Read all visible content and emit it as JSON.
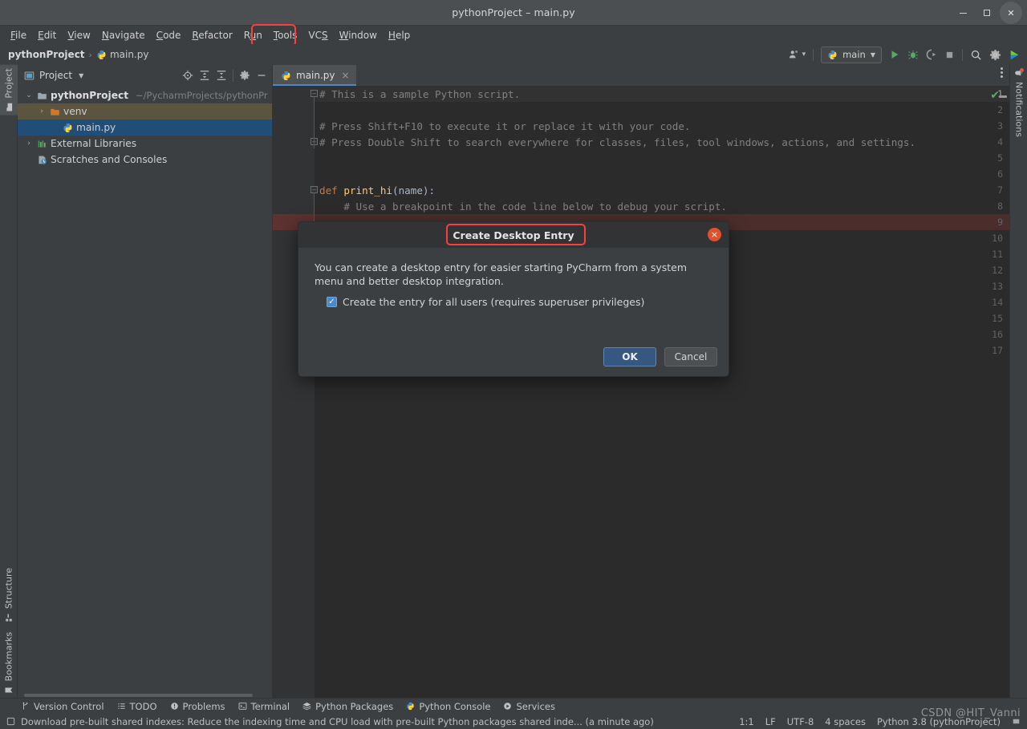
{
  "window": {
    "title": "pythonProject – main.py",
    "minimize_label": "Minimize",
    "maximize_label": "Maximize",
    "close_label": "Close"
  },
  "menubar": {
    "items": [
      {
        "label": "File",
        "mnemonic": "F"
      },
      {
        "label": "Edit",
        "mnemonic": "E"
      },
      {
        "label": "View",
        "mnemonic": "V"
      },
      {
        "label": "Navigate",
        "mnemonic": "N"
      },
      {
        "label": "Code",
        "mnemonic": "C"
      },
      {
        "label": "Refactor",
        "mnemonic": "R"
      },
      {
        "label": "Run",
        "mnemonic": "u"
      },
      {
        "label": "Tools",
        "mnemonic": "T"
      },
      {
        "label": "VCS",
        "mnemonic": "S"
      },
      {
        "label": "Window",
        "mnemonic": "W"
      },
      {
        "label": "Help",
        "mnemonic": "H"
      }
    ],
    "highlighted": "Tools"
  },
  "navbar": {
    "project_name": "pythonProject",
    "separator": "›",
    "file_name": "main.py",
    "account_label": "Account",
    "run_config": "main",
    "run_label": "Run",
    "debug_label": "Debug",
    "coverage_label": "Run with Coverage",
    "stop_label": "Stop",
    "search_label": "Search Everywhere",
    "settings_label": "Settings",
    "ai_label": "AI Assistant"
  },
  "left_strip": {
    "tabs": [
      {
        "label": "Project",
        "icon": "project-icon",
        "active": true
      },
      {
        "label": "Structure",
        "icon": "structure-icon",
        "active": false
      },
      {
        "label": "Bookmarks",
        "icon": "bookmark-icon",
        "active": false
      }
    ]
  },
  "right_strip": {
    "tabs": [
      {
        "label": "Notifications",
        "icon": "bell-icon",
        "badge": true
      }
    ]
  },
  "project_panel": {
    "title": "Project",
    "toolbar": [
      {
        "name": "locate-icon",
        "label": "Select Opened File"
      },
      {
        "name": "expand-all-icon",
        "label": "Expand All"
      },
      {
        "name": "collapse-all-icon",
        "label": "Collapse All"
      },
      {
        "name": "gear-icon",
        "label": "Options"
      },
      {
        "name": "minimize-icon",
        "label": "Hide"
      }
    ],
    "tree": [
      {
        "label": "pythonProject",
        "path": "~/PycharmProjects/pythonPr",
        "indent": 0,
        "arrow": "⌄",
        "icon": "folder-icon",
        "bold": true,
        "state": "normal"
      },
      {
        "label": "venv",
        "path": "",
        "indent": 1,
        "arrow": "›",
        "icon": "folder-orange-icon",
        "bold": false,
        "state": "hover"
      },
      {
        "label": "main.py",
        "path": "",
        "indent": 2,
        "arrow": "",
        "icon": "python-file-icon",
        "bold": false,
        "state": "selected"
      },
      {
        "label": "External Libraries",
        "path": "",
        "indent": 0,
        "arrow": "›",
        "icon": "libraries-icon",
        "bold": false,
        "state": "normal"
      },
      {
        "label": "Scratches and Consoles",
        "path": "",
        "indent": 0,
        "arrow": "",
        "icon": "scratches-icon",
        "bold": false,
        "state": "normal"
      }
    ]
  },
  "editor": {
    "tabs": [
      {
        "label": "main.py",
        "icon": "python-file-icon",
        "active": true,
        "close": "×"
      }
    ],
    "options_label": "Options",
    "inspection_status": "✔",
    "lines": [
      {
        "n": "1",
        "segments": [
          {
            "t": "# This is a sample Python script.",
            "c": "cmt"
          }
        ],
        "fold": "minus",
        "highlight": "caret"
      },
      {
        "n": "2",
        "segments": [],
        "fold": "",
        "highlight": ""
      },
      {
        "n": "3",
        "segments": [
          {
            "t": "# Press Shift+F10 to execute it or replace it with your code.",
            "c": "cmt"
          }
        ],
        "fold": "",
        "highlight": ""
      },
      {
        "n": "4",
        "segments": [
          {
            "t": "# Press Double Shift to search everywhere for classes, files, tool windows, actions, and settings.",
            "c": "cmt"
          }
        ],
        "fold": "minus",
        "highlight": ""
      },
      {
        "n": "5",
        "segments": [],
        "fold": "",
        "highlight": ""
      },
      {
        "n": "6",
        "segments": [],
        "fold": "",
        "highlight": ""
      },
      {
        "n": "7",
        "segments": [
          {
            "t": "def ",
            "c": "kw"
          },
          {
            "t": "print_hi",
            "c": "fn"
          },
          {
            "t": "(name):",
            "c": "pln"
          }
        ],
        "fold": "minus",
        "highlight": ""
      },
      {
        "n": "8",
        "segments": [
          {
            "t": "    # Use a breakpoint in the code line below to debug your script.",
            "c": "cmt"
          }
        ],
        "fold": "",
        "highlight": ""
      },
      {
        "n": "9",
        "segments": [],
        "fold": "",
        "highlight": "breakpoint"
      },
      {
        "n": "10",
        "segments": [],
        "fold": "",
        "highlight": ""
      },
      {
        "n": "11",
        "segments": [],
        "fold": "",
        "highlight": ""
      },
      {
        "n": "12",
        "segments": [],
        "fold": "",
        "highlight": ""
      },
      {
        "n": "13",
        "segments": [],
        "fold": "",
        "highlight": "",
        "changed": true
      },
      {
        "n": "14",
        "segments": [],
        "fold": "",
        "highlight": ""
      },
      {
        "n": "15",
        "segments": [],
        "fold": "",
        "highlight": ""
      },
      {
        "n": "16",
        "segments": [],
        "fold": "",
        "highlight": ""
      },
      {
        "n": "17",
        "segments": [],
        "fold": "",
        "highlight": ""
      }
    ]
  },
  "dialog": {
    "title": "Create Desktop Entry",
    "close": "×",
    "message": "You can create a desktop entry for easier starting PyCharm from a system menu and better desktop integration.",
    "checkbox": {
      "label": "Create the entry for all users (requires superuser privileges)",
      "checked": true,
      "mark": "✓"
    },
    "ok_label": "OK",
    "cancel_label": "Cancel"
  },
  "tool_window_bar": {
    "items": [
      {
        "label": "Version Control",
        "icon": "branch-icon"
      },
      {
        "label": "TODO",
        "icon": "list-icon"
      },
      {
        "label": "Problems",
        "icon": "warning-icon"
      },
      {
        "label": "Terminal",
        "icon": "terminal-icon"
      },
      {
        "label": "Python Packages",
        "icon": "packages-icon"
      },
      {
        "label": "Python Console",
        "icon": "python-icon"
      },
      {
        "label": "Services",
        "icon": "services-icon"
      }
    ]
  },
  "status_bar": {
    "message_icon": "indexes-icon",
    "message": "Download pre-built shared indexes: Reduce the indexing time and CPU load with pre-built Python packages shared inde... (a minute ago)",
    "caret_position": "1:1",
    "line_separator": "LF",
    "encoding": "UTF-8",
    "indent": "4 spaces",
    "interpreter": "Python 3.8 (pythonProject)",
    "memory_icon": "memory-icon"
  },
  "watermark": "CSDN @HIT_Vanni",
  "colors": {
    "accent_blue": "#4a88c7",
    "selection_blue": "#204e78",
    "highlight_red": "#fb3f3f",
    "close_orange": "#e2502a",
    "run_green": "#59a869",
    "editor_bg": "#2b2b2b",
    "panel_bg": "#3c3f41"
  }
}
